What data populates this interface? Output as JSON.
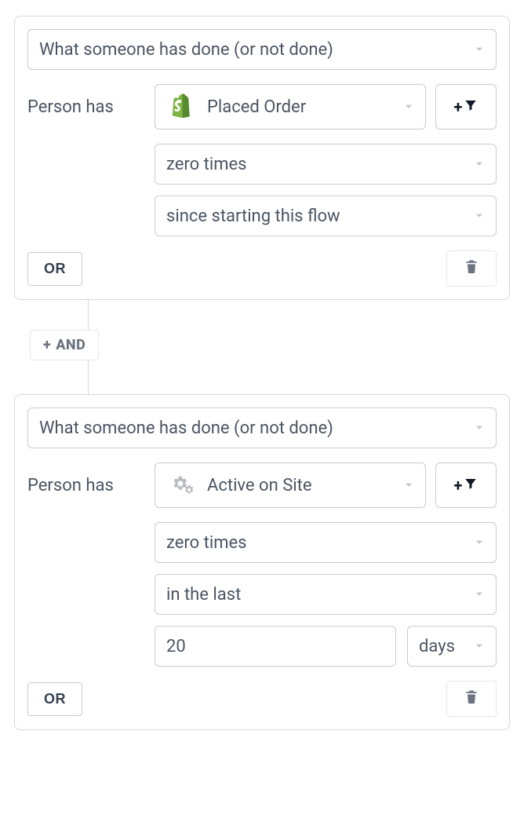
{
  "blocks": [
    {
      "condition_type": "What someone has done (or not done)",
      "person_has_label": "Person has",
      "event": {
        "icon": "shopify",
        "label": "Placed Order"
      },
      "filters": [
        {
          "label": "zero times"
        },
        {
          "label": "since starting this flow"
        }
      ],
      "or_label": "OR"
    },
    {
      "condition_type": "What someone has done (or not done)",
      "person_has_label": "Person has",
      "event": {
        "icon": "gears",
        "label": "Active on Site"
      },
      "filters": [
        {
          "label": "zero times"
        },
        {
          "label": "in the last"
        }
      ],
      "amount": "20",
      "unit": "days",
      "or_label": "OR"
    }
  ],
  "connector": {
    "and_label": "AND"
  }
}
